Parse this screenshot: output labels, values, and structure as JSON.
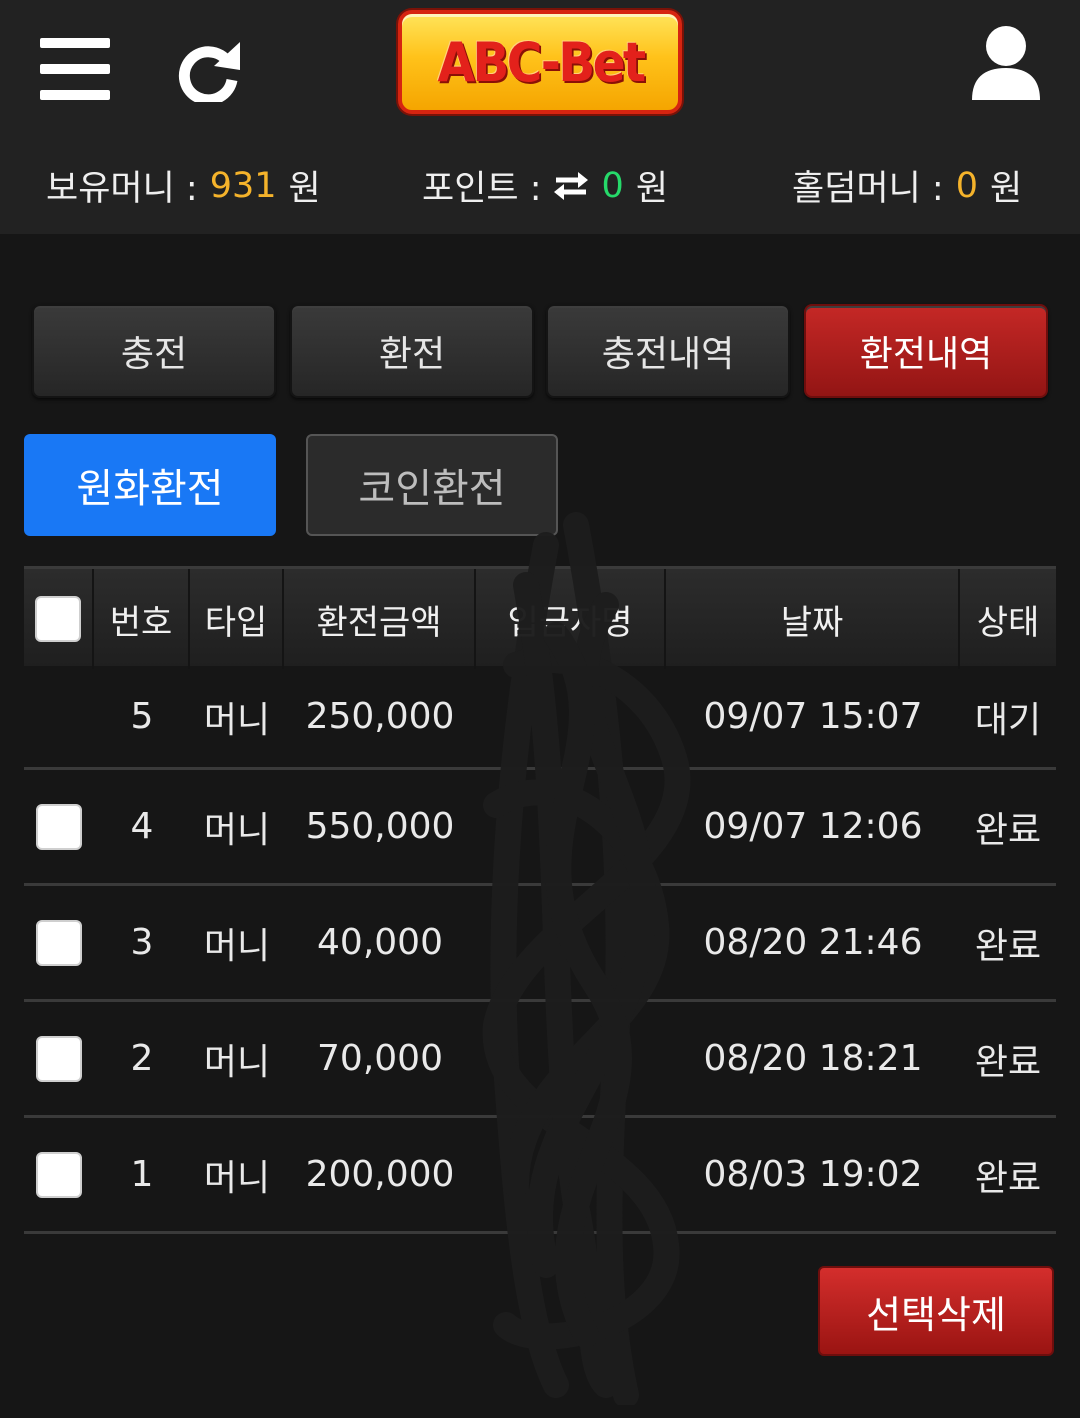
{
  "header": {
    "logo_text": "ABC-Bet",
    "balances": {
      "money_label": "보유머니 :",
      "money_value": "931",
      "point_label": "포인트 :",
      "point_value": "0",
      "holdem_label": "홀덤머니 :",
      "holdem_value": "0",
      "unit": "원"
    }
  },
  "tabs": [
    "충전",
    "환전",
    "충전내역",
    "환전내역"
  ],
  "active_tab": "환전내역",
  "subtabs": [
    "원화환전",
    "코인환전"
  ],
  "active_subtab": "원화환전",
  "table": {
    "headers": {
      "num": "번호",
      "type": "타입",
      "amount": "환전금액",
      "bank": "입금자명",
      "date": "날짜",
      "status": "상태"
    },
    "rows": [
      {
        "num": "5",
        "type": "머니",
        "amount": "250,000",
        "date": "09/07 15:07",
        "status": "대기",
        "checkbox": false
      },
      {
        "num": "4",
        "type": "머니",
        "amount": "550,000",
        "date": "09/07 12:06",
        "status": "완료",
        "checkbox": true
      },
      {
        "num": "3",
        "type": "머니",
        "amount": "40,000",
        "date": "08/20 21:46",
        "status": "완료",
        "checkbox": true
      },
      {
        "num": "2",
        "type": "머니",
        "amount": "70,000",
        "date": "08/20 18:21",
        "status": "완료",
        "checkbox": true
      },
      {
        "num": "1",
        "type": "머니",
        "amount": "200,000",
        "date": "08/03 19:02",
        "status": "완료",
        "checkbox": true
      }
    ]
  },
  "delete_button": "선택삭제",
  "colors": {
    "accent_red": "#b01c1b",
    "accent_blue": "#1978f5",
    "money_yellow": "#f5b32b",
    "point_green": "#26d96a"
  }
}
